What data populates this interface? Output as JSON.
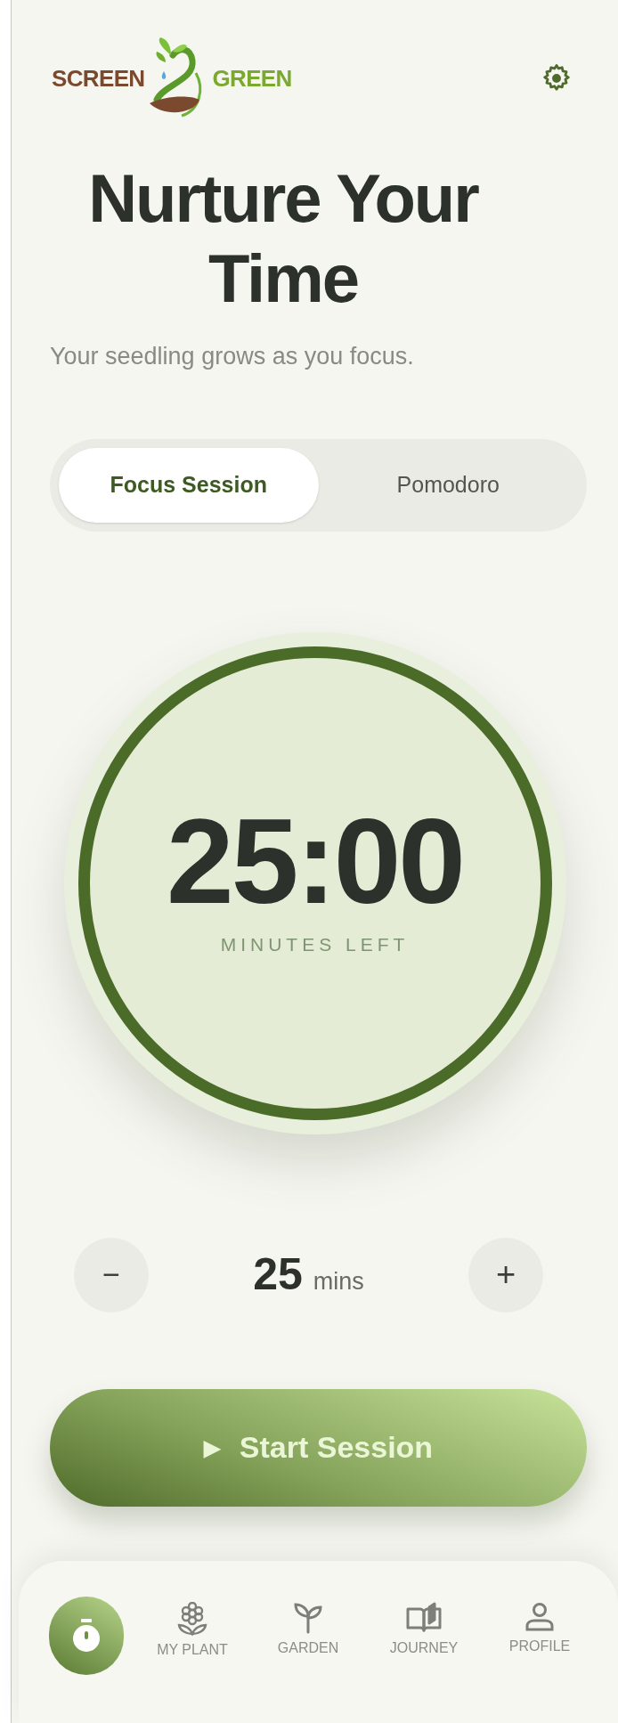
{
  "header": {
    "logo": {
      "left_word": "SCREEN",
      "right_word": "GREEN"
    }
  },
  "title": "Nurture Your Time",
  "subtitle": "Your seedling grows as you focus.",
  "tabs": [
    {
      "label": "Focus Session",
      "selected": true
    },
    {
      "label": "Pomodoro",
      "selected": false
    }
  ],
  "timer": {
    "time": "25:00",
    "caption": "MINUTES LEFT"
  },
  "duration": {
    "decrease": "−",
    "value": "25",
    "unit": "mins",
    "increase": "+"
  },
  "start_button": {
    "icon": "▶",
    "label": "Start Session"
  },
  "nav": {
    "items": [
      {
        "selected": true
      },
      {
        "label": "MY PLANT",
        "selected": false
      },
      {
        "label": "GARDEN",
        "selected": false
      },
      {
        "label": "JOURNEY",
        "selected": false
      },
      {
        "label": "PROFILE",
        "selected": false
      }
    ]
  }
}
